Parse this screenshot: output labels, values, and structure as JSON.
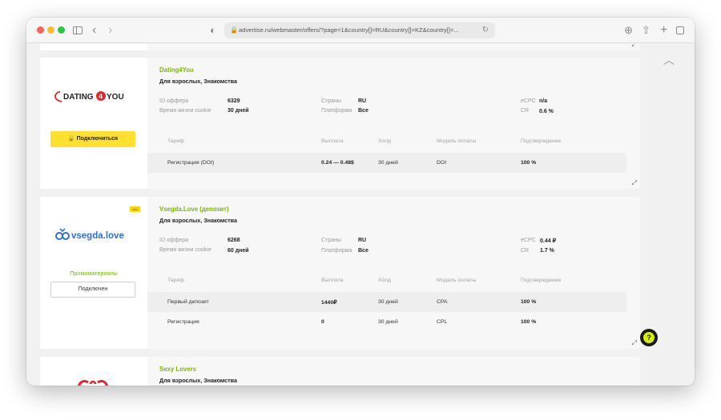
{
  "browser": {
    "url": "advertise.ru/webmaster/offers/?page=1&country[]=RU&country[]=KZ&country[]=..."
  },
  "labels": {
    "offer_id": "ID оффера",
    "cookie": "Время жизни cookie",
    "countries": "Страны",
    "platform": "Платформа",
    "ecpc": "eCPC",
    "cr": "CR",
    "col_tariff": "Тариф",
    "col_payout": "Выплата",
    "col_hold": "Холд",
    "col_model": "Модель оплаты",
    "col_confirm": "Подтверждение"
  },
  "offers": [
    {
      "title": "Dating4You",
      "category": "Для взрослых, Знакомства",
      "logo_text": "DATING YOU",
      "logo_digit": "4",
      "id": "6329",
      "cookie": "30 дней",
      "countries": "RU",
      "platform": "Все",
      "ecpc": "n/a",
      "cr": "0.6 %",
      "button": "Подключиться",
      "rows": [
        {
          "tariff": "Регистрация (DOI)",
          "payout": "0.24 — 0.48$",
          "hold": "30 дней",
          "model": "DOI",
          "confirm": "100 %"
        }
      ]
    },
    {
      "title": "Vsegda.Love (депозит)",
      "category": "Для взрослых, Знакомства",
      "logo_text": "vsegda.love",
      "badge": "new",
      "id": "6268",
      "cookie": "60 дней",
      "countries": "RU",
      "platform": "Все",
      "ecpc": "0.44 ₽",
      "cr": "1.7 %",
      "promo": "Промоматериалы",
      "button": "Подключен",
      "rows": [
        {
          "tariff": "Первый депозит",
          "payout": "1440₽",
          "hold": "30 дней",
          "model": "CPA",
          "confirm": "100 %"
        },
        {
          "tariff": "Регистрация",
          "payout": "0",
          "hold": "30 дней",
          "model": "CPL",
          "confirm": "100 %"
        }
      ]
    },
    {
      "title": "Sexy Lovers",
      "category": "Для взрослых, Знакомства"
    }
  ],
  "colors": {
    "accent_green": "#7bb800",
    "button_yellow": "#ffe02e",
    "logo_red": "#e8232c",
    "vsegda_blue": "#2f6fdc"
  }
}
